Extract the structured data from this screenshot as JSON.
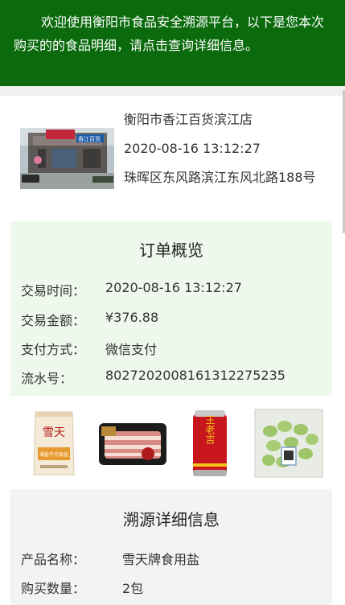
{
  "banner": {
    "text": "欢迎使用衡阳市食品安全溯源平台，以下是您本次购买的的食品明细，请点击查询详细信息。"
  },
  "store": {
    "name": "衡阳市香江百货滨江店",
    "datetime": "2020-08-16 13:12:27",
    "address": "珠晖区东风路滨江东风北路188号",
    "sign_text": "香江百货"
  },
  "order": {
    "title": "订单概览",
    "fields": [
      {
        "label": "交易时间：",
        "value": "2020-08-16 13:12:27"
      },
      {
        "label": "交易金额：",
        "value": "¥376.88"
      },
      {
        "label": "支付方式：",
        "value": "微信支付"
      },
      {
        "label": "流水号：",
        "value": "80272020081613122752​35"
      }
    ]
  },
  "products": [
    {
      "name": "雪天牌食用盐",
      "icon": "salt-bag-icon",
      "pack_brand": "雪天",
      "pack_sub": "湘盐牛代食盐"
    },
    {
      "name": "五花肉",
      "icon": "pork-tray-icon"
    },
    {
      "name": "王老吉",
      "icon": "can-icon",
      "can_text": "王老吉"
    },
    {
      "name": "毛豆",
      "icon": "edamame-pack-icon"
    }
  ],
  "trace": {
    "title": "溯源详细信息",
    "fields": [
      {
        "label": "产品名称：",
        "value": "雪天牌食用盐"
      },
      {
        "label": "购买数量：",
        "value": "2包"
      }
    ]
  },
  "colors": {
    "banner_bg": "#0a6a0c",
    "order_panel_bg": "#eef8ec",
    "trace_panel_bg": "#f3f3f3"
  }
}
